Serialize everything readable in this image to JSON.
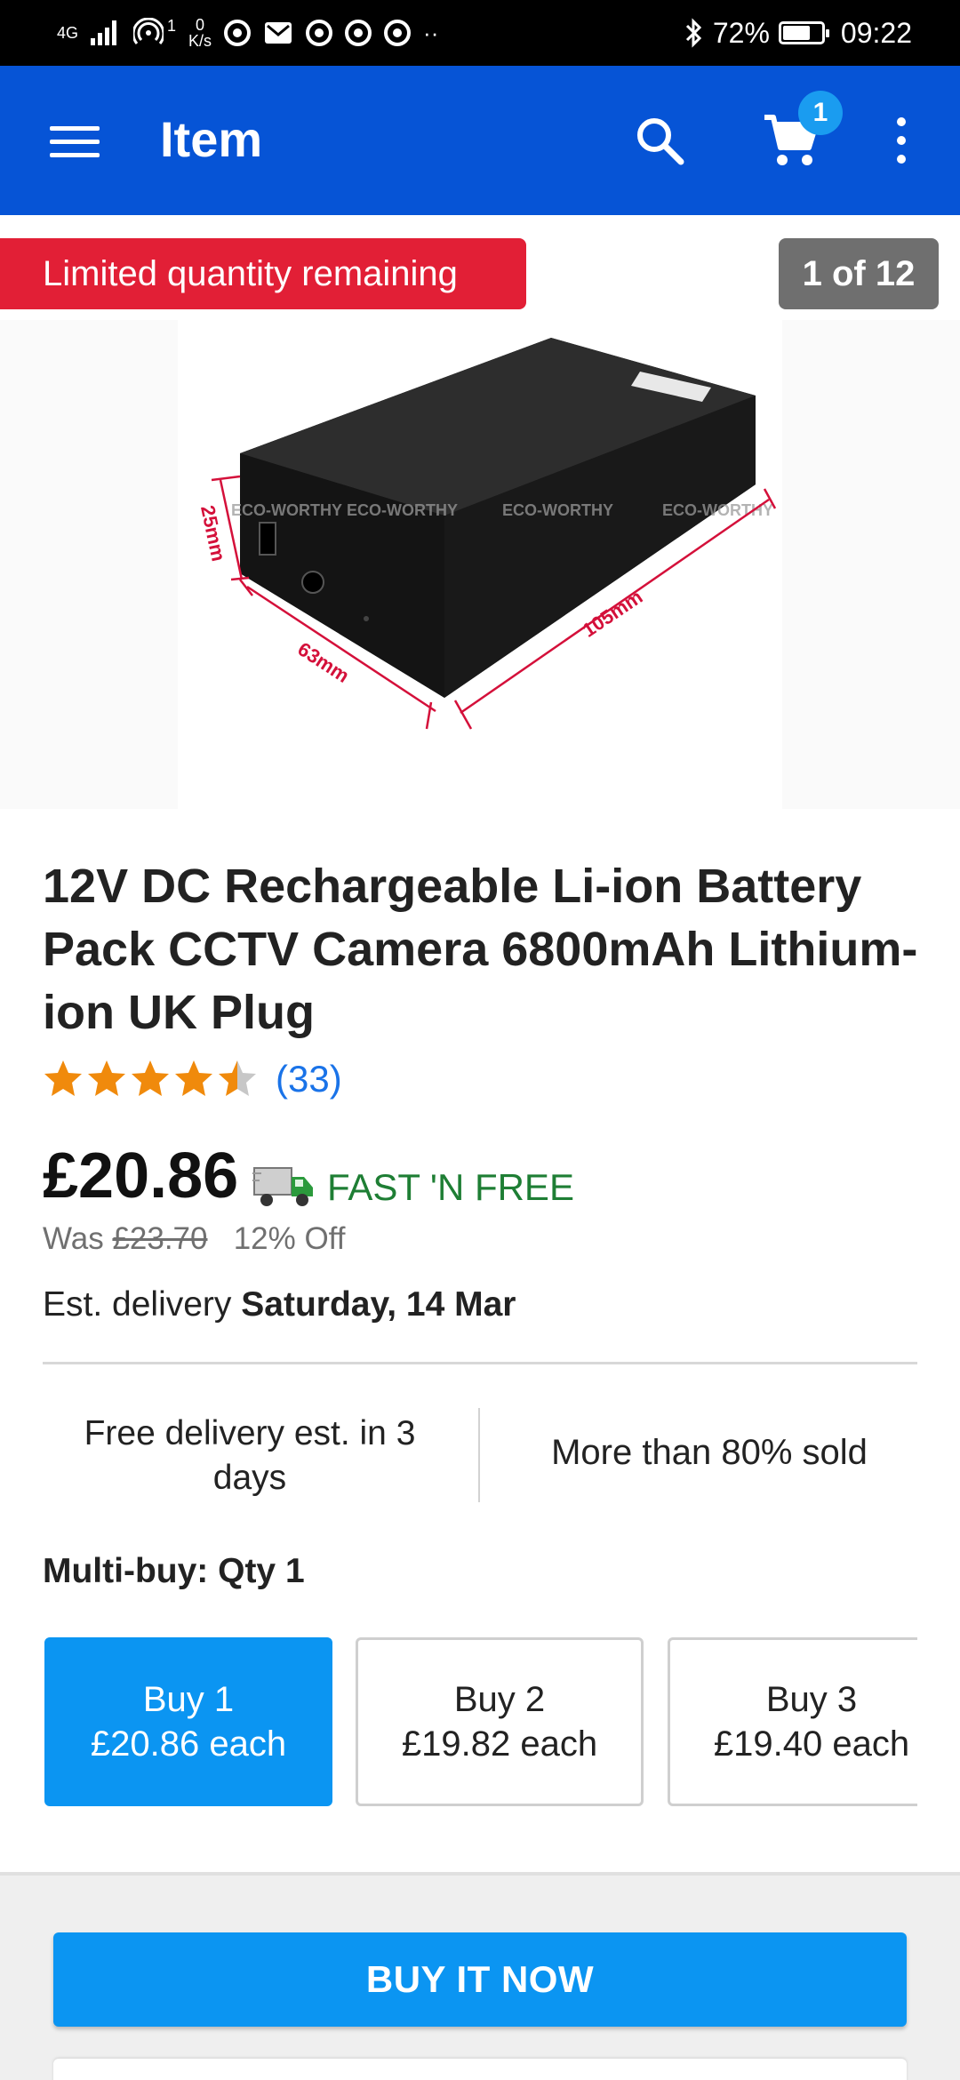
{
  "status_bar": {
    "network": "4G",
    "sim_number": "1",
    "speed_value": "0",
    "speed_unit": "K/s",
    "more": "··",
    "battery_percent": "72%",
    "battery_level": 0.72,
    "time": "09:22"
  },
  "app_bar": {
    "title": "Item",
    "cart_count": "1",
    "icons": [
      "menu-icon",
      "search-icon",
      "cart-icon",
      "more-vert-icon"
    ]
  },
  "gallery": {
    "banner": "Limited quantity remaining",
    "counter": "1 of 12",
    "image": {
      "dimension_height": "25mm",
      "dimension_width": "63mm",
      "dimension_length": "105mm",
      "watermark": "ECO-WORTHY"
    }
  },
  "product": {
    "title": "12V DC Rechargeable Li-ion Battery Pack CCTV Camera 6800mAh Lithium-ion UK Plug",
    "rating_value": 4.5,
    "rating_count": "(33)",
    "price": "£20.86",
    "shipping_label": "FAST 'N FREE",
    "was_label": "Was",
    "was_price": "£23.70",
    "discount": "12% Off",
    "delivery_label": "Est. delivery",
    "delivery_date": "Saturday, 14 Mar"
  },
  "info": {
    "left": "Free delivery est. in 3 days",
    "right": "More than 80% sold"
  },
  "multibuy": {
    "heading": "Multi-buy: Qty 1",
    "options": [
      {
        "label": "Buy 1",
        "price": "£20.86 each",
        "selected": true
      },
      {
        "label": "Buy 2",
        "price": "£19.82 each",
        "selected": false
      },
      {
        "label": "Buy 3",
        "price": "£19.40 each",
        "selected": false
      }
    ]
  },
  "actions": {
    "buy_now": "BUY IT NOW"
  },
  "colors": {
    "app_bar": "#0654d6",
    "banner": "#e21f36",
    "primary_button": "#0b95f2",
    "rating_star": "#f08a0c",
    "shipping_green": "#1e7e34"
  }
}
